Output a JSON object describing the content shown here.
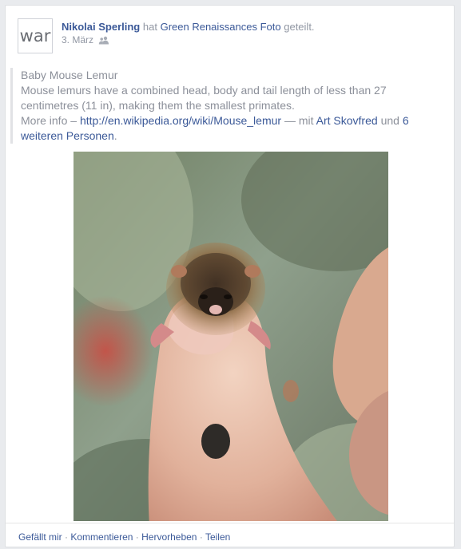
{
  "avatar": {
    "text": "war"
  },
  "header": {
    "author": "Nikolai Sperling",
    "verb_shared": "hat",
    "page_name": "Green Renaissance",
    "shared_suffix": "s Foto",
    "shared_text": "geteilt.",
    "date": "3. März",
    "audience_icon": "friends-icon"
  },
  "post": {
    "title": "Baby Mouse Lemur",
    "body": "Mouse lemurs have a combined head, body and tail length of less than 27 centimetres (11 in), making them the smallest primates.",
    "more_info_label": "More info –",
    "link": "http://en.wikipedia.org/wiki/Mouse_lemur",
    "with_text": "— mit",
    "tagged_person": "Art Skovfred",
    "and_text": "und",
    "others_link": "6 weiteren Personen",
    "end": "."
  },
  "actions": {
    "like": "Gefällt mir",
    "comment": "Kommentieren",
    "highlight": "Hervorheben",
    "share": "Teilen",
    "separator": "·"
  },
  "colors": {
    "link": "#3b5998",
    "secondary_text": "#9197a3",
    "background": "#e9ebee"
  }
}
